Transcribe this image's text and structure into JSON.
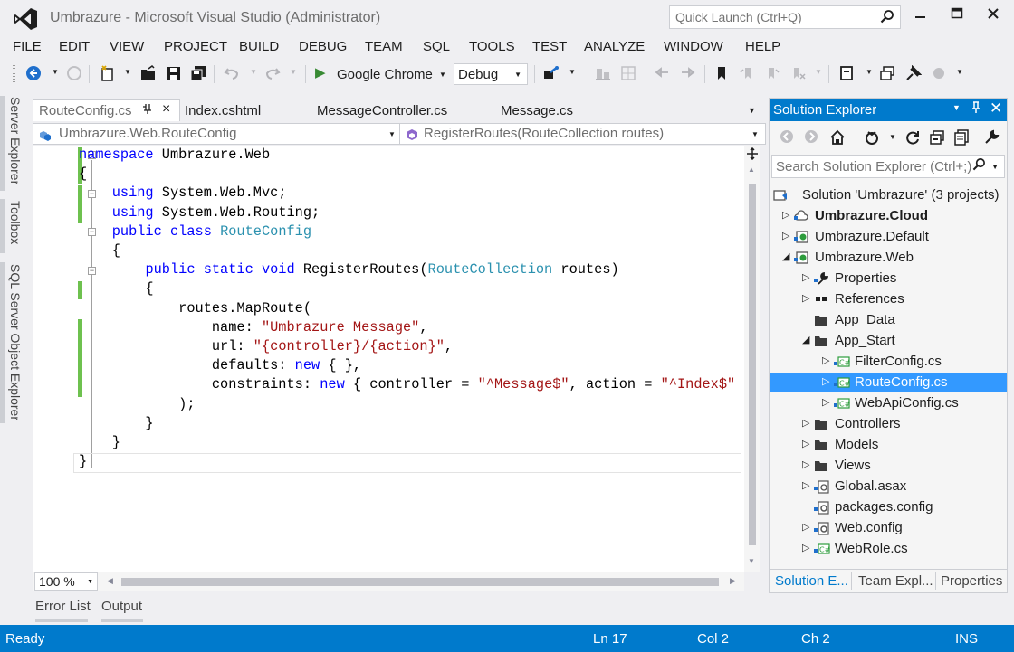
{
  "window": {
    "title": "Umbrazure - Microsoft Visual Studio (Administrator)",
    "quick_launch_placeholder": "Quick Launch (Ctrl+Q)",
    "icons": [
      "vs-logo-icon",
      "search-icon",
      "minimize-icon",
      "maximize-icon",
      "close-icon"
    ]
  },
  "menu": [
    "FILE",
    "EDIT",
    "VIEW",
    "PROJECT",
    "BUILD",
    "DEBUG",
    "TEAM",
    "SQL",
    "TOOLS",
    "TEST",
    "ANALYZE",
    "WINDOW",
    "HELP"
  ],
  "toolbar": {
    "run_target": "Google Chrome",
    "configuration": "Debug"
  },
  "left_tool_windows": [
    "Server Explorer",
    "Toolbox",
    "SQL Server Object Explorer"
  ],
  "doc_tabs": [
    {
      "label": "RouteConfig.cs",
      "active": true
    },
    {
      "label": "Index.cshtml",
      "active": false
    },
    {
      "label": "MessageController.cs",
      "active": false
    },
    {
      "label": "Message.cs",
      "active": false
    }
  ],
  "nav_bar": {
    "type": "Umbrazure.Web.RouteConfig",
    "member": "RegisterRoutes(RouteCollection routes)"
  },
  "code_lines": [
    "namespace Umbrazure.Web",
    "{",
    "    using System.Web.Mvc;",
    "    using System.Web.Routing;",
    "    public class RouteConfig",
    "    {",
    "        public static void RegisterRoutes(RouteCollection routes)",
    "        {",
    "            routes.MapRoute(",
    "                name: \"Umbrazure Message\",",
    "                url: \"{controller}/{action}\",",
    "                defaults: new { },",
    "                constraints: new { controller = \"^Message$\", action = \"^Index$\" }",
    "            );",
    "        }",
    "    }",
    "}"
  ],
  "zoom": "100 %",
  "bottom_tabs": [
    "Error List",
    "Output"
  ],
  "solution_explorer": {
    "title": "Solution Explorer",
    "search_placeholder": "Search Solution Explorer (Ctrl+;)",
    "tree": [
      {
        "label": "Solution 'Umbrazure' (3 projects)",
        "depth": 0,
        "arrow": "",
        "icon": "solution-icon"
      },
      {
        "label": "Umbrazure.Cloud",
        "depth": 1,
        "arrow": "▷",
        "icon": "cloud-project-icon",
        "bold": true
      },
      {
        "label": "Umbrazure.Default",
        "depth": 1,
        "arrow": "▷",
        "icon": "web-project-icon"
      },
      {
        "label": "Umbrazure.Web",
        "depth": 1,
        "arrow": "◢",
        "icon": "web-project-icon"
      },
      {
        "label": "Properties",
        "depth": 2,
        "arrow": "▷",
        "icon": "properties-icon"
      },
      {
        "label": "References",
        "depth": 2,
        "arrow": "▷",
        "icon": "references-icon"
      },
      {
        "label": "App_Data",
        "depth": 2,
        "arrow": "",
        "icon": "folder-icon"
      },
      {
        "label": "App_Start",
        "depth": 2,
        "arrow": "◢",
        "icon": "folder-icon"
      },
      {
        "label": "FilterConfig.cs",
        "depth": 3,
        "arrow": "▷",
        "icon": "csharp-file-icon"
      },
      {
        "label": "RouteConfig.cs",
        "depth": 3,
        "arrow": "▷",
        "icon": "csharp-file-icon",
        "selected": true
      },
      {
        "label": "WebApiConfig.cs",
        "depth": 3,
        "arrow": "▷",
        "icon": "csharp-file-icon"
      },
      {
        "label": "Controllers",
        "depth": 2,
        "arrow": "▷",
        "icon": "folder-icon"
      },
      {
        "label": "Models",
        "depth": 2,
        "arrow": "▷",
        "icon": "folder-icon"
      },
      {
        "label": "Views",
        "depth": 2,
        "arrow": "▷",
        "icon": "folder-icon"
      },
      {
        "label": "Global.asax",
        "depth": 2,
        "arrow": "▷",
        "icon": "asax-file-icon"
      },
      {
        "label": "packages.config",
        "depth": 2,
        "arrow": "",
        "icon": "config-file-icon"
      },
      {
        "label": "Web.config",
        "depth": 2,
        "arrow": "▷",
        "icon": "config-file-icon"
      },
      {
        "label": "WebRole.cs",
        "depth": 2,
        "arrow": "▷",
        "icon": "csharp-file-icon"
      }
    ],
    "bottom_tabs": [
      "Solution E...",
      "Team Expl...",
      "Properties"
    ]
  },
  "status_bar": {
    "state": "Ready",
    "line": "Ln 17",
    "col": "Col 2",
    "ch": "Ch 2",
    "mode": "INS"
  },
  "colors": {
    "accent": "#007acc",
    "selection": "#3399ff",
    "keyword": "#0000ff",
    "type": "#2b91af",
    "string": "#a31515",
    "change_bar": "#6ec14f"
  }
}
